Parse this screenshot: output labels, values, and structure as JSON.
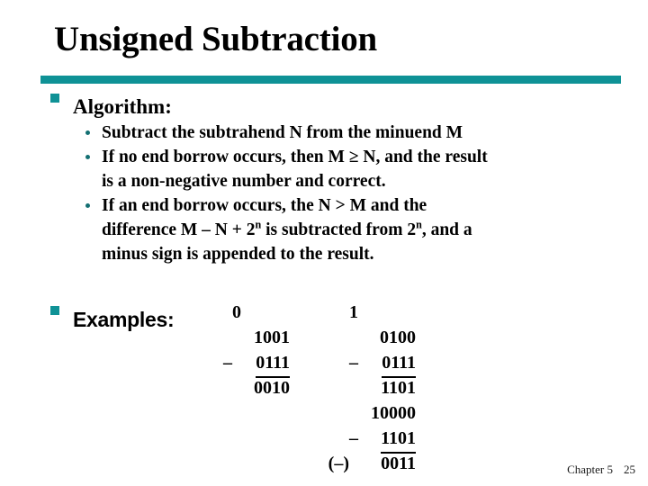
{
  "slide": {
    "title": "Unsigned Subtraction",
    "accent_color": "#0f9296",
    "rule_color": "#0f9296"
  },
  "sections": {
    "algorithm": {
      "heading": "Algorithm:",
      "bullet_icon": "square-bullet-icon",
      "points": [
        {
          "lines": [
            "Subtract the subtrahend N from the minuend M"
          ]
        },
        {
          "lines": [
            "If no end borrow occurs, then M ≥ N, and the result",
            "is a non-negative number and correct."
          ]
        },
        {
          "lines": [
            "If an end borrow occurs, the N > M and the",
            "difference M – N + 2ⁿ is subtracted from 2ⁿ, and a",
            "minus sign is appended to the result."
          ],
          "line_parts": [
            [
              {
                "t": "If an end borrow occurs, the N > M and the"
              }
            ],
            [
              {
                "t": "difference M – N + 2"
              },
              {
                "t": "n",
                "sup": true
              },
              {
                "t": " is subtracted from 2"
              },
              {
                "t": "n",
                "sup": true
              },
              {
                "t": ", and a"
              }
            ],
            [
              {
                "t": "minus sign is appended to the result."
              }
            ]
          ]
        }
      ]
    },
    "examples": {
      "heading": "Examples:",
      "bullet_icon": "square-bullet-icon",
      "columns": [
        {
          "name": "example-left",
          "rows": [
            {
              "kind": "borrow",
              "op": "",
              "digits": "0",
              "ruled": false
            },
            {
              "kind": "operand",
              "op": "",
              "digits": "1001",
              "ruled": false
            },
            {
              "kind": "operand",
              "op": "–",
              "digits": "0111",
              "ruled": true
            },
            {
              "kind": "result",
              "op": "",
              "digits": "0010",
              "ruled": false
            }
          ]
        },
        {
          "name": "example-right",
          "rows": [
            {
              "kind": "borrow",
              "op": "",
              "digits": "1",
              "ruled": false
            },
            {
              "kind": "operand",
              "op": "",
              "digits": "0100",
              "ruled": false
            },
            {
              "kind": "operand",
              "op": "–",
              "digits": "0111",
              "ruled": true
            },
            {
              "kind": "result",
              "op": "",
              "digits": "1101",
              "ruled": false
            },
            {
              "kind": "operand",
              "op": "",
              "digits": "10000",
              "ruled": false
            },
            {
              "kind": "operand",
              "op": "–",
              "digits": "1101",
              "ruled": true
            },
            {
              "kind": "result",
              "op": "(–)",
              "digits": "0011",
              "ruled": false
            }
          ]
        }
      ]
    }
  },
  "footer": {
    "chapter": "Chapter 5",
    "page": "25"
  }
}
